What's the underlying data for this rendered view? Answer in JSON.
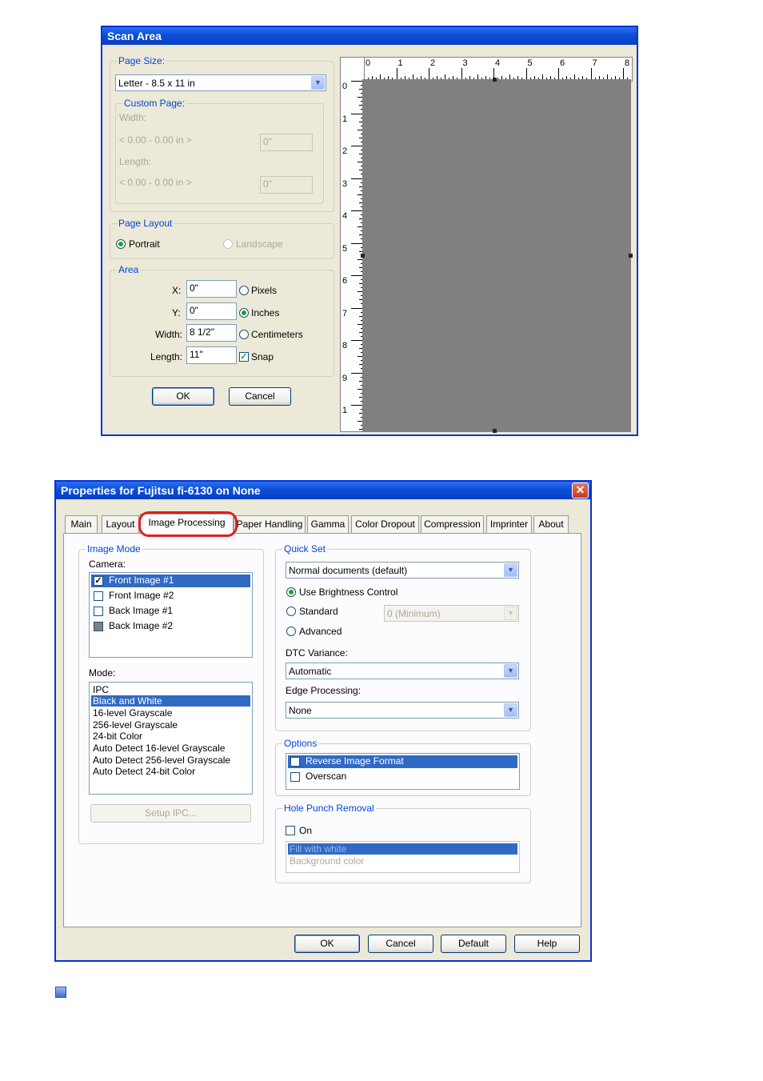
{
  "scan_area": {
    "title": "Scan Area",
    "page_size": {
      "label": "Page Size:",
      "value": "Letter - 8.5 x 11 in"
    },
    "custom_page": {
      "label": "Custom Page:",
      "width_label": "Width:",
      "width_range": "< 0.00 - 0.00 in >",
      "width_value": "0\"",
      "length_label": "Length:",
      "length_range": "< 0.00 - 0.00 in >",
      "length_value": "0\""
    },
    "page_layout": {
      "label": "Page Layout",
      "portrait": "Portrait",
      "landscape": "Landscape"
    },
    "area": {
      "label": "Area",
      "x_label": "X:",
      "x_value": "0\"",
      "y_label": "Y:",
      "y_value": "0\"",
      "width_label": "Width:",
      "width_value": "8 1/2\"",
      "length_label": "Length:",
      "length_value": "11\"",
      "pixels": "Pixels",
      "inches": "Inches",
      "centimeters": "Centimeters",
      "snap": "Snap",
      "unit_selected": "Inches",
      "snap_checked": true
    },
    "ok": "OK",
    "cancel": "Cancel",
    "ruler_h": [
      "0",
      "1",
      "2",
      "3",
      "4",
      "5",
      "6",
      "7",
      "8"
    ],
    "ruler_v": [
      "0",
      "1",
      "2",
      "3",
      "4",
      "5",
      "6",
      "7",
      "8",
      "9",
      "1"
    ],
    "preview_color": "#808080"
  },
  "properties": {
    "title": "Properties for Fujitsu fi-6130 on None",
    "close_glyph": "✕",
    "tabs": [
      "Main",
      "Layout",
      "Image Processing",
      "Paper Handling",
      "Gamma",
      "Color Dropout",
      "Compression",
      "Imprinter",
      "About"
    ],
    "active_tab": "Image Processing",
    "highlight_color": "#e0201c",
    "image_mode": {
      "label": "Image Mode",
      "camera_label": "Camera:",
      "cameras": [
        {
          "label": "Front Image #1",
          "checked": true,
          "selected": true
        },
        {
          "label": "Front Image #2",
          "checked": false,
          "selected": false
        },
        {
          "label": "Back Image #1",
          "checked": false,
          "selected": false
        },
        {
          "label": "Back Image #2",
          "checked": false,
          "selected": false
        }
      ],
      "mode_label": "Mode:",
      "modes": [
        "IPC",
        "Black and White",
        "16-level Grayscale",
        "256-level Grayscale",
        "24-bit Color",
        "Auto Detect 16-level Grayscale",
        "Auto Detect 256-level Grayscale",
        "Auto Detect 24-bit Color"
      ],
      "mode_selected": "Black and White",
      "setup_ipc": "Setup IPC..."
    },
    "quick_set": {
      "label": "Quick Set",
      "preset": "Normal documents (default)",
      "use_brightness": "Use Brightness Control",
      "standard": "Standard",
      "standard_value": "0 (Minimum)",
      "advanced": "Advanced",
      "dtc_label": "DTC Variance:",
      "dtc_value": "Automatic",
      "edge_label": "Edge Processing:",
      "edge_value": "None"
    },
    "options": {
      "label": "Options",
      "items": [
        {
          "label": "Reverse Image Format",
          "checked": false,
          "selected": true
        },
        {
          "label": "Overscan",
          "checked": false,
          "selected": false
        }
      ]
    },
    "hole_punch": {
      "label": "Hole Punch Removal",
      "on_label": "On",
      "items": [
        "Fill with white",
        "Background color"
      ]
    },
    "buttons": {
      "ok": "OK",
      "cancel": "Cancel",
      "default": "Default",
      "help": "Help"
    }
  }
}
